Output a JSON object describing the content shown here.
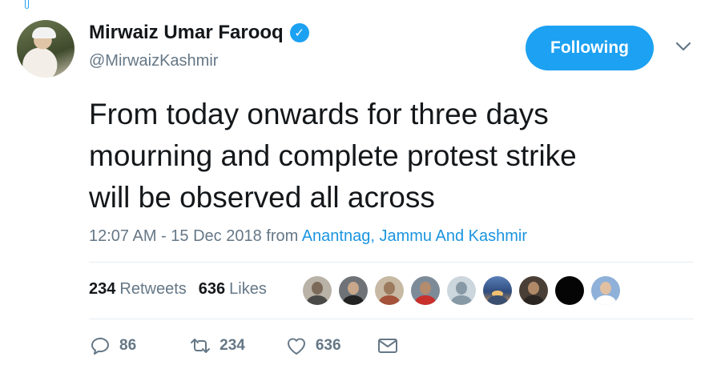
{
  "author": {
    "name": "Mirwaiz Umar Farooq",
    "handle": "@MirwaizKashmir"
  },
  "follow_button": {
    "label": "Following"
  },
  "tweet": {
    "text": "From today onwards for three days\nmourning and complete  protest strike\nwill be observed all across",
    "timestamp": "12:07 AM - 15 Dec 2018",
    "from_label": "from",
    "location": "Anantnag, Jammu And Kashmir"
  },
  "stats": {
    "retweets_count": "234",
    "retweets_label": "Retweets",
    "likes_count": "636",
    "likes_label": "Likes"
  },
  "actions": {
    "replies": "86",
    "retweets": "234",
    "likes": "636"
  },
  "colors": {
    "accent": "#1da1f2",
    "link": "#1b95e0",
    "muted": "#657786"
  },
  "icons": {
    "verified": "verified-badge-icon",
    "caret": "chevron-down-icon",
    "reply": "reply-icon",
    "retweet": "retweet-icon",
    "like": "heart-icon",
    "dm": "envelope-icon"
  }
}
